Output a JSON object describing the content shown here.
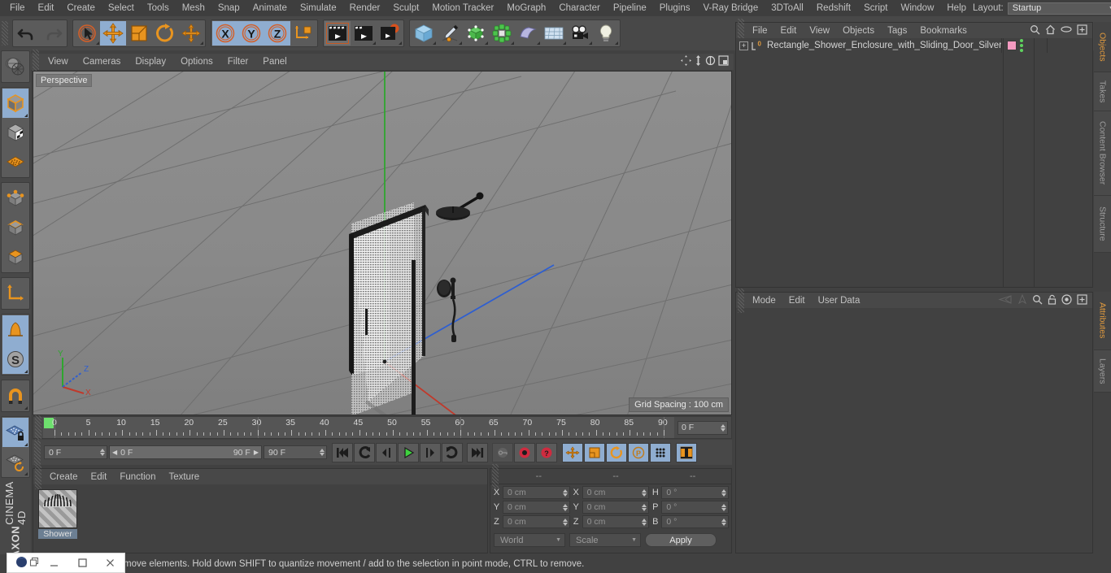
{
  "menubar": {
    "items": [
      "File",
      "Edit",
      "Create",
      "Select",
      "Tools",
      "Mesh",
      "Snap",
      "Animate",
      "Simulate",
      "Render",
      "Sculpt",
      "Motion Tracker",
      "MoGraph",
      "Character",
      "Pipeline",
      "Plugins",
      "V-Ray Bridge",
      "3DToAll",
      "Redshift",
      "Script",
      "Window",
      "Help"
    ],
    "layout_label": "Layout:",
    "layout_value": "Startup",
    "search_icon": "search-icon"
  },
  "toolbar": {
    "groups": [
      {
        "name": "undo-redo",
        "buttons": [
          {
            "icon": "undo-icon",
            "state": "normal"
          },
          {
            "icon": "redo-icon",
            "state": "disabled"
          }
        ]
      },
      {
        "name": "transform-tools",
        "buttons": [
          {
            "icon": "live-selection-icon",
            "state": "normal"
          },
          {
            "icon": "move-icon",
            "state": "selected"
          },
          {
            "icon": "scale-icon",
            "state": "normal"
          },
          {
            "icon": "rotate-icon",
            "state": "normal"
          },
          {
            "icon": "move-axis-icon",
            "state": "normal"
          }
        ]
      },
      {
        "name": "axis-locks",
        "buttons": [
          {
            "icon": "x-axis-icon",
            "state": "selected",
            "label": "X"
          },
          {
            "icon": "y-axis-icon",
            "state": "selected",
            "label": "Y"
          },
          {
            "icon": "z-axis-icon",
            "state": "selected",
            "label": "Z"
          },
          {
            "icon": "world-coordinate-icon",
            "state": "normal"
          }
        ]
      },
      {
        "name": "render-tools",
        "buttons": [
          {
            "icon": "render-view-icon",
            "state": "active"
          },
          {
            "icon": "render-region-icon",
            "state": "normal"
          },
          {
            "icon": "render-settings-icon",
            "state": "normal"
          }
        ]
      },
      {
        "name": "object-tools",
        "buttons": [
          {
            "icon": "cube-primitive-icon",
            "state": "normal"
          },
          {
            "icon": "spline-pen-icon",
            "state": "normal"
          },
          {
            "icon": "generator-nurbs-icon",
            "state": "normal"
          },
          {
            "icon": "array-cloner-icon",
            "state": "normal"
          },
          {
            "icon": "deformer-bend-icon",
            "state": "normal"
          },
          {
            "icon": "environment-floor-icon",
            "state": "normal"
          },
          {
            "icon": "camera-icon",
            "state": "normal"
          },
          {
            "icon": "light-bulb-icon",
            "state": "normal"
          }
        ]
      }
    ]
  },
  "left_toolbar": {
    "groups": [
      {
        "buttons": [
          {
            "icon": "make-editable-icon",
            "state": "normal"
          }
        ]
      },
      {
        "buttons": [
          {
            "icon": "model-mode-icon",
            "state": "selected"
          },
          {
            "icon": "texture-mode-icon",
            "state": "normal"
          },
          {
            "icon": "workplane-mode-icon",
            "state": "normal"
          }
        ]
      },
      {
        "buttons": [
          {
            "icon": "point-mode-icon",
            "state": "normal"
          },
          {
            "icon": "edge-mode-icon",
            "state": "normal"
          },
          {
            "icon": "polygon-mode-icon",
            "state": "normal"
          }
        ]
      },
      {
        "buttons": [
          {
            "icon": "object-axis-icon",
            "state": "normal"
          }
        ]
      },
      {
        "buttons": [
          {
            "icon": "viewport-solo-icon",
            "state": "selected"
          },
          {
            "icon": "enable-snap-icon",
            "state": "selected"
          }
        ]
      },
      {
        "buttons": [
          {
            "icon": "magnet-icon",
            "state": "normal"
          }
        ]
      },
      {
        "buttons": [
          {
            "icon": "workplane-lock-icon",
            "state": "selected"
          },
          {
            "icon": "workplane-rotate-icon",
            "state": "normal"
          }
        ]
      }
    ],
    "brand_maxon": "MAXON",
    "brand_product": "CINEMA 4D"
  },
  "viewport": {
    "menu_items": [
      "View",
      "Cameras",
      "Display",
      "Options",
      "Filter",
      "Panel"
    ],
    "corner_icons": [
      "pan-icon",
      "zoom-icon",
      "rotate-icon",
      "maximize-icon"
    ],
    "label": "Perspective",
    "grid_spacing": "Grid Spacing : 100 cm",
    "axis_gizmo": {
      "x": "X",
      "y": "Y",
      "z": "Z"
    },
    "scene_description": "Rectangular shower enclosure with sliding glass door, rain shower head and handheld shower"
  },
  "timeline": {
    "ticks": [
      0,
      5,
      10,
      15,
      20,
      25,
      30,
      35,
      40,
      45,
      50,
      55,
      60,
      65,
      70,
      75,
      80,
      85,
      90
    ],
    "current_frame_field": "0 F",
    "start": 0,
    "end": 90
  },
  "playbar": {
    "current_frame": "0 F",
    "range_start": "0 F",
    "range_end": "90 F",
    "end_frame": "90 F",
    "buttons": [
      {
        "icon": "go-to-start-icon",
        "state": "normal"
      },
      {
        "icon": "play-reverse-loop-icon",
        "state": "normal"
      },
      {
        "icon": "step-back-icon",
        "state": "normal"
      },
      {
        "icon": "play-icon",
        "state": "normal"
      },
      {
        "icon": "step-forward-icon",
        "state": "normal"
      },
      {
        "icon": "play-forward-loop-icon",
        "state": "normal"
      },
      {
        "icon": "go-to-end-icon",
        "state": "normal"
      },
      {
        "icon": "autokey-icon",
        "state": "disabled"
      },
      {
        "icon": "record-keyframe-icon",
        "state": "normal"
      },
      {
        "icon": "keyframe-selection-icon",
        "state": "normal"
      },
      {
        "icon": "position-key-icon",
        "state": "selected"
      },
      {
        "icon": "scale-key-icon",
        "state": "selected"
      },
      {
        "icon": "rotation-key-icon",
        "state": "selected"
      },
      {
        "icon": "param-key-icon",
        "state": "selected"
      },
      {
        "icon": "point-level-anim-icon",
        "state": "selected"
      },
      {
        "icon": "timeline-icon",
        "state": "selected"
      }
    ]
  },
  "material_manager": {
    "menu_items": [
      "Create",
      "Edit",
      "Function",
      "Texture"
    ],
    "materials": [
      {
        "name": "Shower",
        "preview": "shower-head-preview"
      }
    ]
  },
  "coordinates": {
    "headers": [
      "--",
      "--",
      "--"
    ],
    "rows": [
      {
        "pos_label": "X",
        "pos_value": "0 cm",
        "size_label": "X",
        "size_value": "0 cm",
        "rot_label": "H",
        "rot_value": "0 °"
      },
      {
        "pos_label": "Y",
        "pos_value": "0 cm",
        "size_label": "Y",
        "size_value": "0 cm",
        "rot_label": "P",
        "rot_value": "0 °"
      },
      {
        "pos_label": "Z",
        "pos_value": "0 cm",
        "size_label": "Z",
        "size_value": "0 cm",
        "rot_label": "B",
        "rot_value": "0 °"
      }
    ],
    "coord_system": "World",
    "transform_mode": "Scale",
    "apply_label": "Apply"
  },
  "object_manager": {
    "menu_items": [
      "File",
      "Edit",
      "View",
      "Objects",
      "Tags",
      "Bookmarks"
    ],
    "header_icons": [
      "search-icon",
      "home-icon",
      "eye-icon",
      "add-icon"
    ],
    "objects": [
      {
        "name": "Rectangle_Shower_Enclosure_with_Sliding_Door_Silver",
        "level_badge": "0",
        "tag_color": "#f49ac1",
        "has_green_dots": true
      }
    ]
  },
  "attribute_manager": {
    "menu_items": [
      "Mode",
      "Edit",
      "User Data"
    ],
    "header_icons": [
      "prev-icon",
      "pin-icon",
      "search-icon",
      "lock-icon",
      "target-icon",
      "add-icon"
    ]
  },
  "right_tabs": {
    "top": [
      {
        "label": "Objects",
        "active": true
      },
      {
        "label": "Takes",
        "active": false
      },
      {
        "label": "Content Browser",
        "active": false
      },
      {
        "label": "Structure",
        "active": false
      }
    ],
    "bottom": [
      {
        "label": "Attributes",
        "active": true
      },
      {
        "label": "Layers",
        "active": false
      }
    ]
  },
  "statusbar": {
    "message": "move elements. Hold down SHIFT to quantize movement / add to the selection in point mode, CTRL to remove."
  },
  "taskbar": {
    "app_icon": "cinema4d-icon",
    "restore_icon": "restore-icon",
    "minimize_icon": "minimize-icon",
    "maximize_icon": "maximize-icon",
    "close_icon": "close-icon"
  },
  "colors": {
    "accent": "#e09a3e",
    "selected_tool": "#8fadd0",
    "panel_bg": "#414141",
    "toolbar_bg": "#484848",
    "viewport_bg": "#8a8a8a",
    "tag_pink": "#f49ac1",
    "axis_x": "#c0392b",
    "axis_y": "#27ae60",
    "axis_z": "#2f5fd0"
  }
}
